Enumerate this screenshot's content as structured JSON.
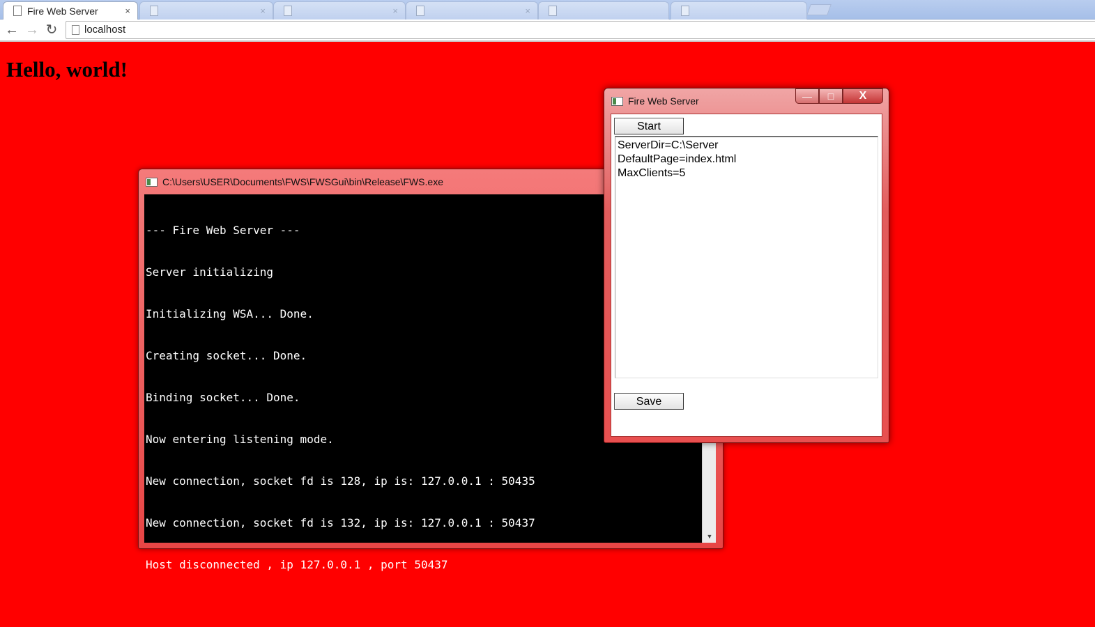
{
  "browser": {
    "active_tab": {
      "title": "Fire Web Server",
      "close": "×"
    },
    "background_tabs": [
      {
        "title": "",
        "close": "×"
      },
      {
        "title": "",
        "close": "×"
      },
      {
        "title": "",
        "close": "×"
      },
      {
        "title": "",
        "close": ""
      },
      {
        "title": "",
        "close": ""
      }
    ],
    "nav": {
      "back": "←",
      "forward": "→",
      "reload": "↻"
    },
    "address": "localhost"
  },
  "page": {
    "heading": "Hello, world!"
  },
  "console_window": {
    "title": "C:\\Users\\USER\\Documents\\FWS\\FWSGui\\bin\\Release\\FWS.exe",
    "lines": [
      "--- Fire Web Server ---",
      "Server initializing",
      "Initializing WSA... Done.",
      "Creating socket... Done.",
      "Binding socket... Done.",
      "Now entering listening mode.",
      "New connection, socket fd is 128, ip is: 127.0.0.1 : 50435",
      "New connection, socket fd is 132, ip is: 127.0.0.1 : 50437",
      "Host disconnected , ip 127.0.0.1 , port 50437"
    ],
    "scroll_arrow": "▼"
  },
  "gui_window": {
    "title": "Fire Web Server",
    "minimize": "—",
    "maximize": "□",
    "close": "X",
    "start_label": "Start",
    "save_label": "Save",
    "config_lines": [
      "ServerDir=C:\\Server",
      "DefaultPage=index.html",
      "MaxClients=5"
    ]
  },
  "colors": {
    "page_background": "#ff0000",
    "console_background": "#000000"
  }
}
